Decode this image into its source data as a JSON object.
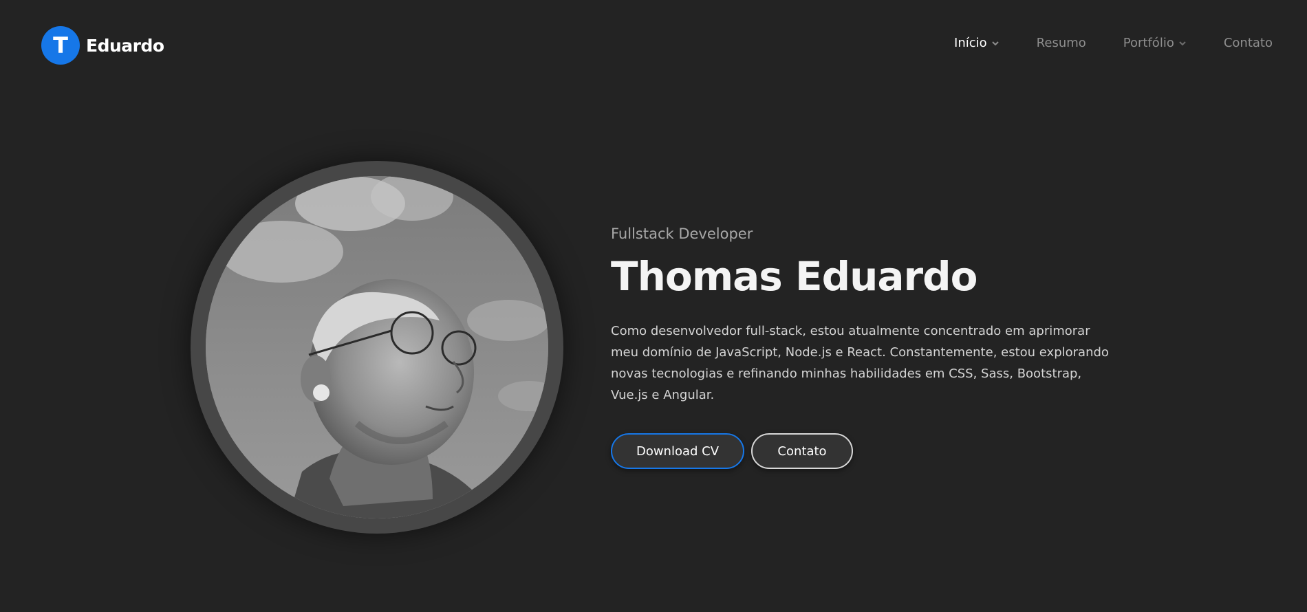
{
  "header": {
    "logo_letter": "T",
    "logo_name": "Eduardo",
    "brand_color": "#1677e8",
    "nav": [
      {
        "label": "Início",
        "has_dropdown": true,
        "active": true
      },
      {
        "label": "Resumo",
        "has_dropdown": false,
        "active": false
      },
      {
        "label": "Portfólio",
        "has_dropdown": true,
        "active": false
      },
      {
        "label": "Contato",
        "has_dropdown": false,
        "active": false
      }
    ]
  },
  "hero": {
    "subtitle": "Fullstack Developer",
    "name": "Thomas Eduardo",
    "bio": "Como desenvolvedor full-stack, estou atualmente concentrado em aprimorar meu domínio de JavaScript, Node.js e React. Constantemente, estou explorando novas tecnologias e refinando minhas habilidades em CSS, Sass, Bootstrap, Vue.js e Angular.",
    "buttons": {
      "download_cv": "Download CV",
      "contact": "Contato"
    }
  },
  "colors": {
    "background": "#232323",
    "accent": "#1677e8",
    "ring": "#474747"
  }
}
